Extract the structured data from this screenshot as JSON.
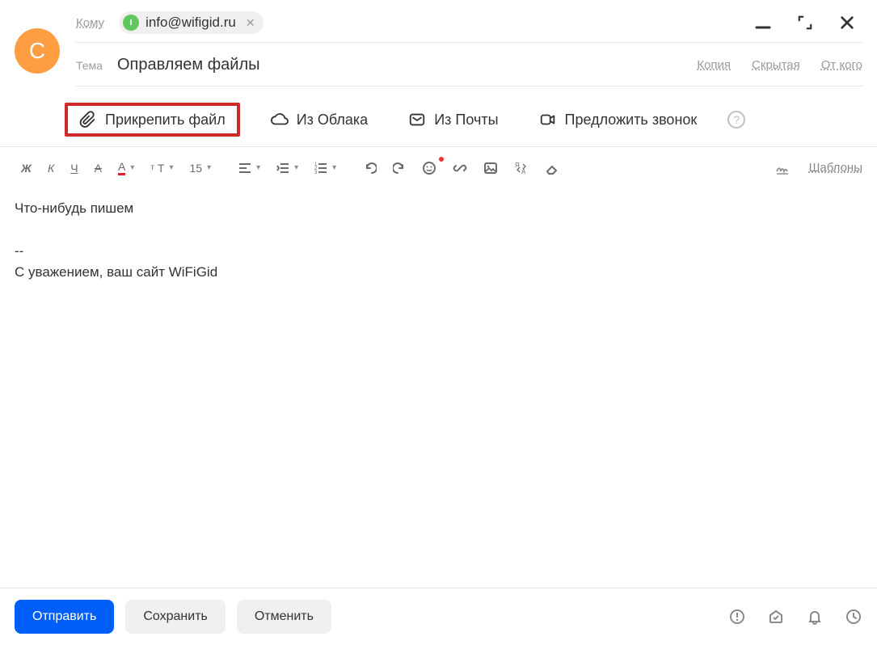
{
  "avatar_letter": "С",
  "to": {
    "label": "Кому",
    "chip_initial": "I",
    "chip_email": "info@wifigid.ru"
  },
  "subject": {
    "label": "Тема",
    "value": "Оправляем файлы",
    "links": {
      "copy": "Копия",
      "hidden": "Скрытая",
      "from": "От кого"
    }
  },
  "attach": {
    "file": "Прикрепить файл",
    "cloud": "Из Облака",
    "mail": "Из Почты",
    "call": "Предложить звонок"
  },
  "format": {
    "font_size": "15",
    "templates": "Шаблоны"
  },
  "body": {
    "line1": "Что-нибудь пишем",
    "sigdash": "--",
    "sigline": "С уважением, ваш сайт WiFiGid"
  },
  "footer": {
    "send": "Отправить",
    "save": "Сохранить",
    "cancel": "Отменить"
  }
}
